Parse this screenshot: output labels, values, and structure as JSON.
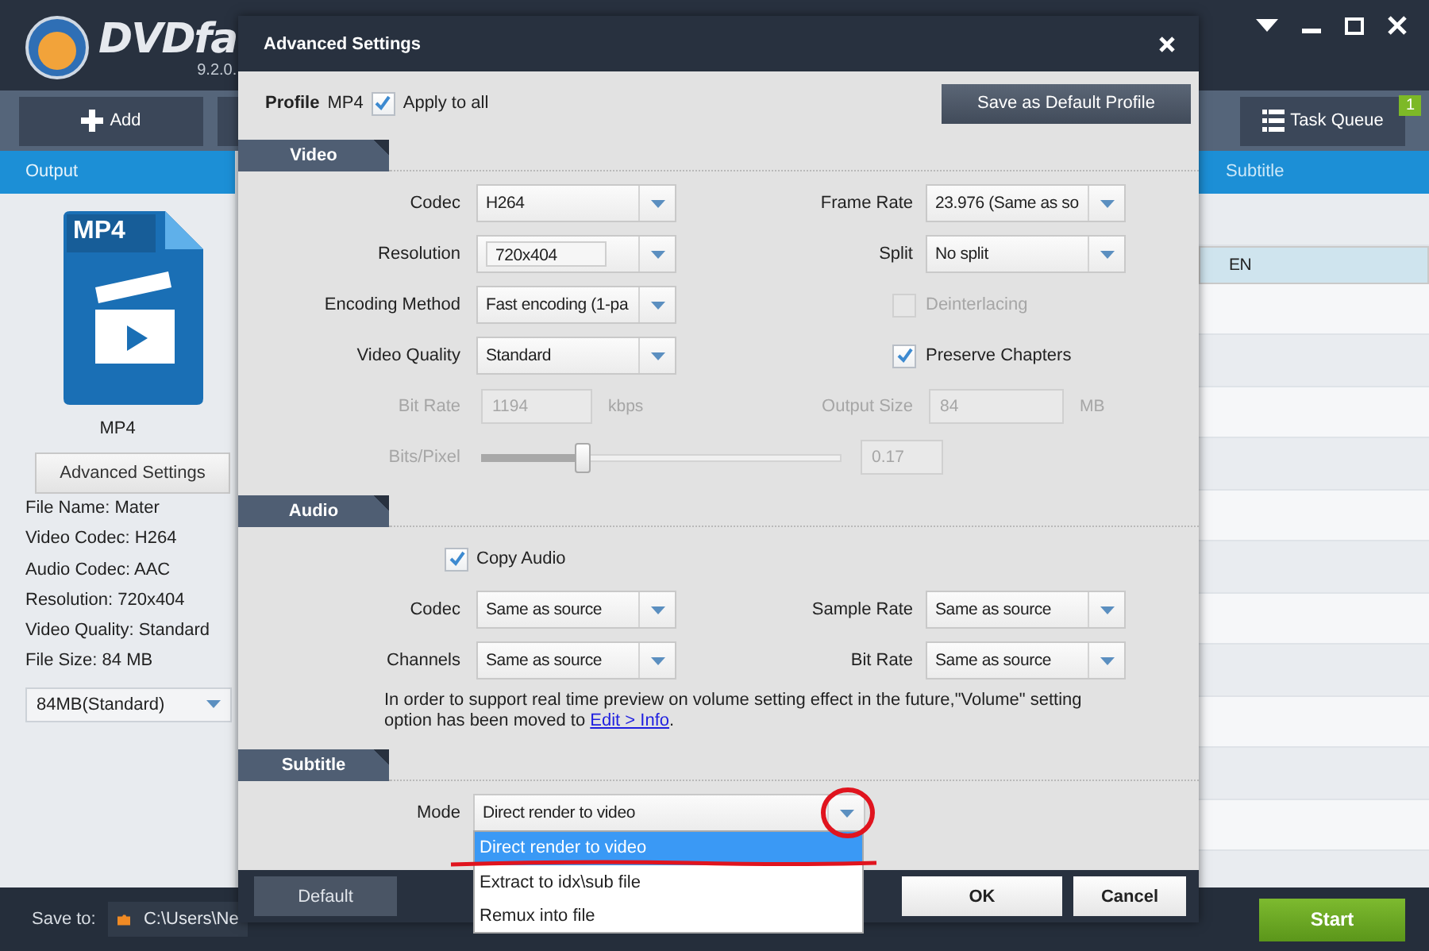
{
  "app": {
    "logo": "DVDfa",
    "version": "9.2.0."
  },
  "toolbar": {
    "add_button": "Add",
    "task_queue": {
      "label": "Task Queue",
      "badge": "1"
    }
  },
  "output_panel": {
    "header": "Output",
    "format_icon_label": "MP4",
    "format_name": "MP4",
    "advanced_button": "Advanced Settings",
    "info": [
      "File Name: Mater",
      "Video Codec: H264",
      "Audio Codec: AAC",
      "Resolution: 720x404",
      "Video Quality: Standard",
      "File Size: 84 MB"
    ],
    "size_select": "84MB(Standard)"
  },
  "task_table": {
    "columns": [
      "Subtitle"
    ],
    "rows": [
      {
        "selected": true,
        "subtitle": "EN"
      }
    ]
  },
  "save_bar": {
    "label": "Save to:",
    "path": "C:\\Users\\Ne",
    "start_button": "Start"
  },
  "dialog": {
    "title": "Advanced Settings",
    "profile": {
      "label": "Profile",
      "value": "MP4",
      "apply_to_all": {
        "label": "Apply to all",
        "checked": true
      }
    },
    "save_default_button": "Save as Default Profile",
    "sections": [
      {
        "title": "Video",
        "rows": [
          {
            "fields": [
              {
                "kind": "select",
                "label": "Codec",
                "value": "H264"
              },
              {
                "kind": "select",
                "label": "Frame Rate",
                "value": "23.976 (Same as so"
              }
            ]
          },
          {
            "fields": [
              {
                "kind": "combo",
                "label": "Resolution",
                "value": "720x404"
              },
              {
                "kind": "select",
                "label": "Split",
                "value": "No split"
              }
            ]
          },
          {
            "fields": [
              {
                "kind": "select",
                "label": "Encoding Method",
                "value": "Fast encoding (1-pa"
              },
              {
                "kind": "checkbox",
                "label": "Deinterlacing",
                "checked": false,
                "disabled": true
              }
            ]
          },
          {
            "fields": [
              {
                "kind": "select",
                "label": "Video Quality",
                "value": "Standard"
              },
              {
                "kind": "checkbox",
                "label": "Preserve Chapters",
                "checked": true,
                "disabled": false
              }
            ]
          },
          {
            "fields": [
              {
                "kind": "input",
                "label": "Bit Rate",
                "value": "1194",
                "unit": "kbps",
                "disabled": true
              },
              {
                "kind": "input",
                "label": "Output Size",
                "value": "84",
                "unit": "MB",
                "disabled": true
              }
            ]
          },
          {
            "fields": [
              {
                "kind": "slider",
                "label": "Bits/Pixel",
                "level": 0.28,
                "value": "0.17",
                "disabled": true
              }
            ]
          }
        ]
      },
      {
        "title": "Audio",
        "rows": [
          {
            "fields": [
              {
                "kind": "checkbox",
                "label": "Copy Audio",
                "checked": true,
                "disabled": false
              }
            ]
          },
          {
            "fields": [
              {
                "kind": "select",
                "label": "Codec",
                "value": "Same as source"
              },
              {
                "kind": "select",
                "label": "Sample Rate",
                "value": "Same as source"
              }
            ]
          },
          {
            "fields": [
              {
                "kind": "select",
                "label": "Channels",
                "value": "Same as source"
              },
              {
                "kind": "select",
                "label": "Bit Rate",
                "value": "Same as source"
              }
            ]
          },
          {
            "fields": [
              {
                "kind": "note",
                "text": "In order to support real time preview on volume setting effect in the future,\"Volume\" setting option has been moved to ",
                "link": "Edit > Info",
                "tail": "."
              }
            ]
          }
        ]
      },
      {
        "title": "Subtitle",
        "rows": [
          {
            "fields": [
              {
                "kind": "open_select",
                "label": "Mode",
                "value": "Direct render to video",
                "options": [
                  {
                    "label": "Direct render to video",
                    "selected": true
                  },
                  {
                    "label": "Extract to idx\\sub file",
                    "selected": false
                  },
                  {
                    "label": "Remux into file",
                    "selected": false
                  }
                ]
              }
            ]
          }
        ]
      }
    ],
    "annotations": {
      "circled_arrow": true,
      "underlined_option": true
    },
    "buttons": {
      "default": "Default",
      "ok": "OK",
      "cancel": "Cancel"
    }
  }
}
